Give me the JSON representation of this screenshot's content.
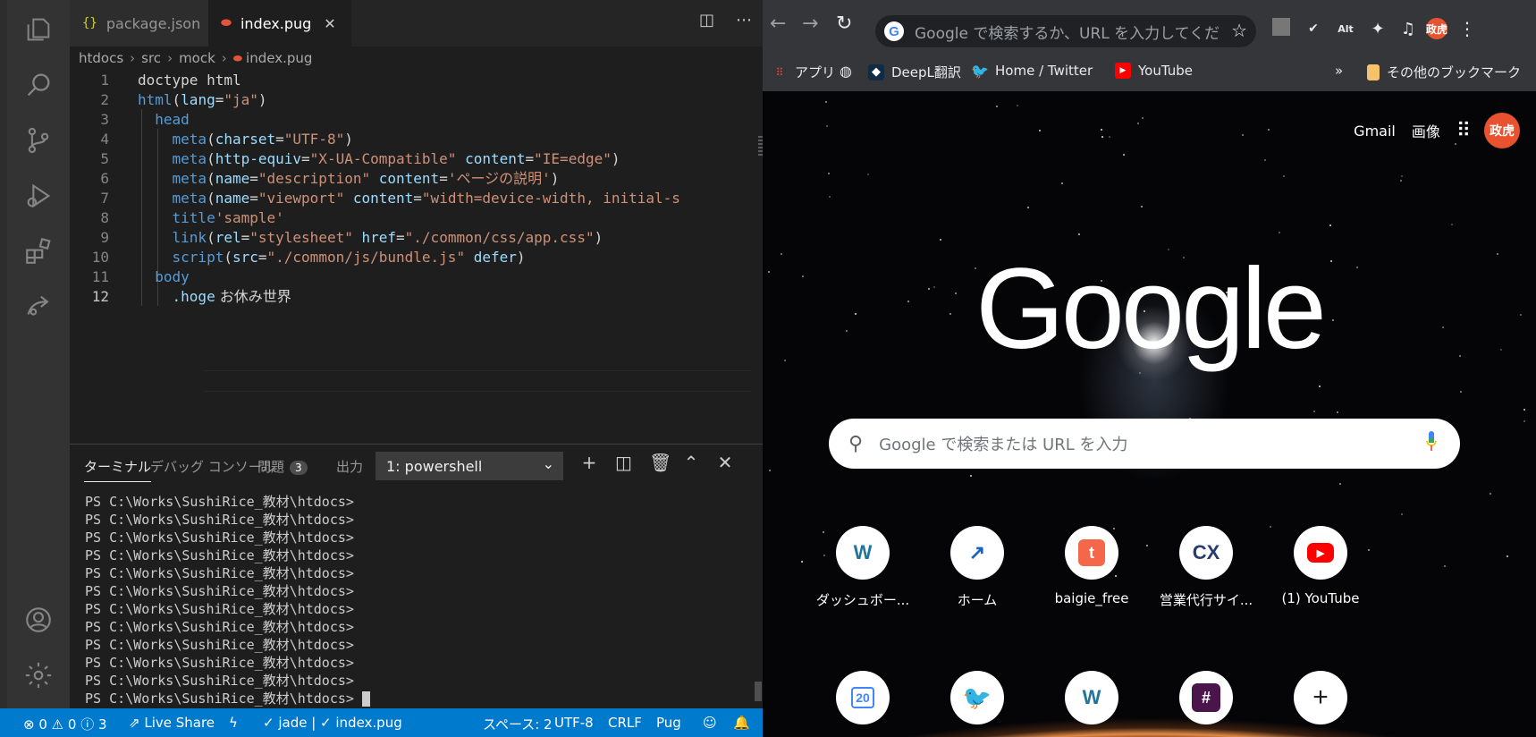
{
  "vscode": {
    "tabs": [
      {
        "icon": "{}",
        "label": "package.json"
      },
      {
        "icon": "pug",
        "label": "index.pug"
      }
    ],
    "breadcrumb": [
      "htdocs",
      "src",
      "mock",
      "index.pug"
    ],
    "code": [
      {
        "n": "1"
      },
      {
        "n": "2"
      },
      {
        "n": "3"
      },
      {
        "n": "4"
      },
      {
        "n": "5"
      },
      {
        "n": "6"
      },
      {
        "n": "7"
      },
      {
        "n": "8"
      },
      {
        "n": "9"
      },
      {
        "n": "10"
      },
      {
        "n": "11"
      },
      {
        "n": "12"
      }
    ],
    "code_text": {
      "l1": "doctype html",
      "l2a": "html",
      "l2b": "(",
      "l2c": "lang",
      "l2d": "=",
      "l2e": "\"ja\"",
      "l2f": ")",
      "l3": "head",
      "l4a": "meta",
      "l4b": "(",
      "l4c": "charset",
      "l4d": "=",
      "l4e": "\"UTF-8\"",
      "l4f": ")",
      "l5a": "meta",
      "l5b": "(",
      "l5c": "http-equiv",
      "l5d": "=",
      "l5e": "\"X-UA-Compatible\"",
      "l5f": " ",
      "l5g": "content",
      "l5h": "=",
      "l5i": "\"IE=edge\"",
      "l5j": ")",
      "l6a": "meta",
      "l6b": "(",
      "l6c": "name",
      "l6d": "=",
      "l6e": "\"description\"",
      "l6f": " ",
      "l6g": "content",
      "l6h": "=",
      "l6i": "'ページの説明'",
      "l6j": ")",
      "l7a": "meta",
      "l7b": "(",
      "l7c": "name",
      "l7d": "=",
      "l7e": "\"viewport\"",
      "l7f": " ",
      "l7g": "content",
      "l7h": "=",
      "l7i": "\"width=device-width, initial-s",
      "l8a": "title",
      "l8b": "'sample'",
      "l9a": "link",
      "l9b": "(",
      "l9c": "rel",
      "l9d": "=",
      "l9e": "\"stylesheet\"",
      "l9f": " ",
      "l9g": "href",
      "l9h": "=",
      "l9i": "\"./common/css/app.css\"",
      "l9j": ")",
      "l10a": "script",
      "l10b": "(",
      "l10c": "src",
      "l10d": "=",
      "l10e": "\"./common/js/bundle.js\"",
      "l10f": " ",
      "l10g": "defer",
      "l10h": ")",
      "l11": "body",
      "l12a": ".hoge",
      "l12b": " お休み世界"
    },
    "panel": {
      "tabs": {
        "terminal": "ターミナル",
        "debug": "デバッグ コンソール",
        "problems": "問題",
        "problems_count": "3",
        "output": "出力"
      },
      "terminal_select": "1: powershell"
    },
    "terminal_lines": [
      "PS C:\\Works\\SushiRice_教材\\htdocs>",
      "PS C:\\Works\\SushiRice_教材\\htdocs>",
      "PS C:\\Works\\SushiRice_教材\\htdocs>",
      "PS C:\\Works\\SushiRice_教材\\htdocs>",
      "PS C:\\Works\\SushiRice_教材\\htdocs>",
      "PS C:\\Works\\SushiRice_教材\\htdocs>",
      "PS C:\\Works\\SushiRice_教材\\htdocs>",
      "PS C:\\Works\\SushiRice_教材\\htdocs>",
      "PS C:\\Works\\SushiRice_教材\\htdocs>",
      "PS C:\\Works\\SushiRice_教材\\htdocs>",
      "PS C:\\Works\\SushiRice_教材\\htdocs>",
      "PS C:\\Works\\SushiRice_教材\\htdocs>"
    ],
    "status": {
      "errors": "0",
      "warnings": "0",
      "infos": "3",
      "live_share": "Live Share",
      "jade": "jade | ✓ index.pug",
      "spaces": "スペース: 2",
      "encoding": "UTF-8",
      "eol": "CRLF",
      "language": "Pug"
    }
  },
  "chrome": {
    "omnibox_placeholder": "Google で検索するか、URL を入力してください",
    "ext_alt": "Alt",
    "profile_initials": "政虎",
    "bookmarks": {
      "apps": "アプリ",
      "deepl": "DeepL翻訳",
      "twitter": "Home / Twitter",
      "youtube": "YouTube",
      "more": "»",
      "other": "その他のブックマーク"
    },
    "ntp": {
      "gmail": "Gmail",
      "images": "画像",
      "logo": "Google",
      "search_placeholder": "Google で検索または URL を入力",
      "shortcuts": [
        {
          "label": "ダッシュボー...",
          "icon": "wordpress-icon"
        },
        {
          "label": "ホーム",
          "icon": "chart-icon"
        },
        {
          "label": "baigie_free",
          "icon": "t-icon"
        },
        {
          "label": "営業代行サイ...",
          "icon": "cx-icon"
        },
        {
          "label": "(1) YouTube",
          "icon": "youtube-icon"
        }
      ],
      "shortcuts_row2": [
        {
          "label": "",
          "icon": "calendar-icon",
          "glyph": "20"
        },
        {
          "label": "",
          "icon": "twitter-icon"
        },
        {
          "label": "",
          "icon": "wordpress-icon"
        },
        {
          "label": "",
          "icon": "slack-icon"
        },
        {
          "label": "",
          "icon": "add-shortcut-icon"
        }
      ]
    }
  },
  "colors": {
    "accent": "#007acc",
    "vscode_bg": "#1e1e1e",
    "chrome_toolbar": "#35363a",
    "avatar": "#e8522e"
  }
}
